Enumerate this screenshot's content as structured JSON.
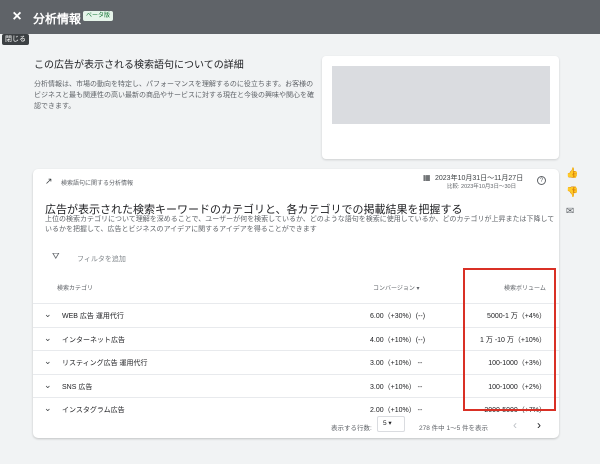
{
  "header": {
    "close_icon": "×",
    "title": "分析情報",
    "badge": "ベータ版",
    "tooltip": "閉じる"
  },
  "intro": {
    "title": "この広告が表示される検索語句についての詳細",
    "description": "分析情報は、市場の動向を特定し、パフォーマンスを理解するのに役立ちます。お客様のビジネスと最も関連性の高い最新の商品やサービスに対する現在と今後の興味や関心を確認できます。"
  },
  "card": {
    "label": "検索語句に関する分析情報",
    "date_range": "2023年10月31日～11月27日",
    "compare_range": "比較: 2023年10月3日～30日",
    "headline": "広告が表示された検索キーワードのカテゴリと、各カテゴリでの掲載結果を把握する",
    "subtext": "上位の検索カテゴリについて理解を深めることで、ユーザーが何を検索しているか、どのような語句を検索に使用しているか、どのカテゴリが上昇または下降しているかを把握して、広告とビジネスのアイデアに関するアイデアを得ることができます",
    "filter_label": "フィルタを追加",
    "columns": {
      "category": "検索カテゴリ",
      "conversions": "コンバージョン ▾",
      "volume": "検索ボリューム"
    },
    "rows": [
      {
        "category": "WEB 広告 運用代行",
        "conversions": "6.00（+30%）(--)",
        "volume": "5000-1 万（+4%）"
      },
      {
        "category": "インターネット広告",
        "conversions": "4.00（+10%）(--)",
        "volume": "1 万 -10 万（+10%）"
      },
      {
        "category": "リスティング広告 運用代行",
        "conversions": "3.00（+10%）  --",
        "volume": "100-1000（+3%）"
      },
      {
        "category": "SNS 広告",
        "conversions": "3.00（+10%）  --",
        "volume": "100-1000（+2%）"
      },
      {
        "category": "インスタグラム広告",
        "conversions": "2.00（+10%）  --",
        "volume": "2000-5000（+7%）"
      }
    ],
    "pager": {
      "rows_label": "表示する行数:",
      "rows_value": "5 ▾",
      "range": "278 件中 1～5 件を表示",
      "prev": "‹",
      "next": "›"
    }
  },
  "side_icons": [
    "thumb-up-icon",
    "thumb-down-icon",
    "feedback-icon"
  ],
  "colors": {
    "topbar": "#5f6368",
    "highlight": "#d93025",
    "background": "#f1f3f4"
  }
}
